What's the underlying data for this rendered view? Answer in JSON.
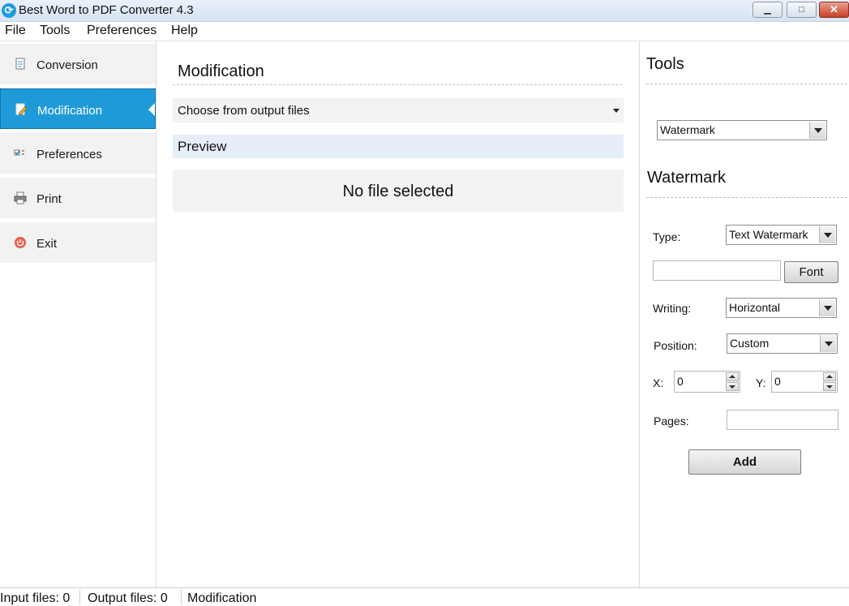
{
  "window": {
    "title": "Best Word to PDF Converter 4.3",
    "icon": "refresh-icon",
    "controls": {
      "minimize": "▁",
      "maximize": "□",
      "close": "✕"
    }
  },
  "menu": {
    "items": [
      "File",
      "Tools",
      "Preferences",
      "Help"
    ]
  },
  "sidebar": {
    "items": [
      {
        "label": "Conversion",
        "icon": "document-convert-icon",
        "active": false
      },
      {
        "label": "Modification",
        "icon": "edit-document-icon",
        "active": true
      },
      {
        "label": "Preferences",
        "icon": "checklist-icon",
        "active": false
      },
      {
        "label": "Print",
        "icon": "printer-icon",
        "active": false
      },
      {
        "label": "Exit",
        "icon": "power-icon",
        "active": false
      }
    ],
    "accent_color": "#1f9ad8"
  },
  "center": {
    "title": "Modification",
    "output_select": {
      "value": "Choose from output files"
    },
    "preview_label": "Preview",
    "empty_message": "No file selected"
  },
  "tools": {
    "title": "Tools",
    "tool_select": {
      "value": "Watermark"
    },
    "watermark": {
      "title": "Watermark",
      "type_label": "Type:",
      "type_value": "Text Watermark",
      "text_value": "",
      "font_button": "Font",
      "writing_label": "Writing:",
      "writing_value": "Horizontal",
      "position_label": "Position:",
      "position_value": "Custom",
      "x_label": "X:",
      "x_value": "0",
      "y_label": "Y:",
      "y_value": "0",
      "pages_label": "Pages:",
      "pages_value": "",
      "add_button": "Add"
    }
  },
  "status": {
    "input_files": "Input files: 0",
    "output_files": "Output files: 0",
    "mode": "Modification"
  }
}
